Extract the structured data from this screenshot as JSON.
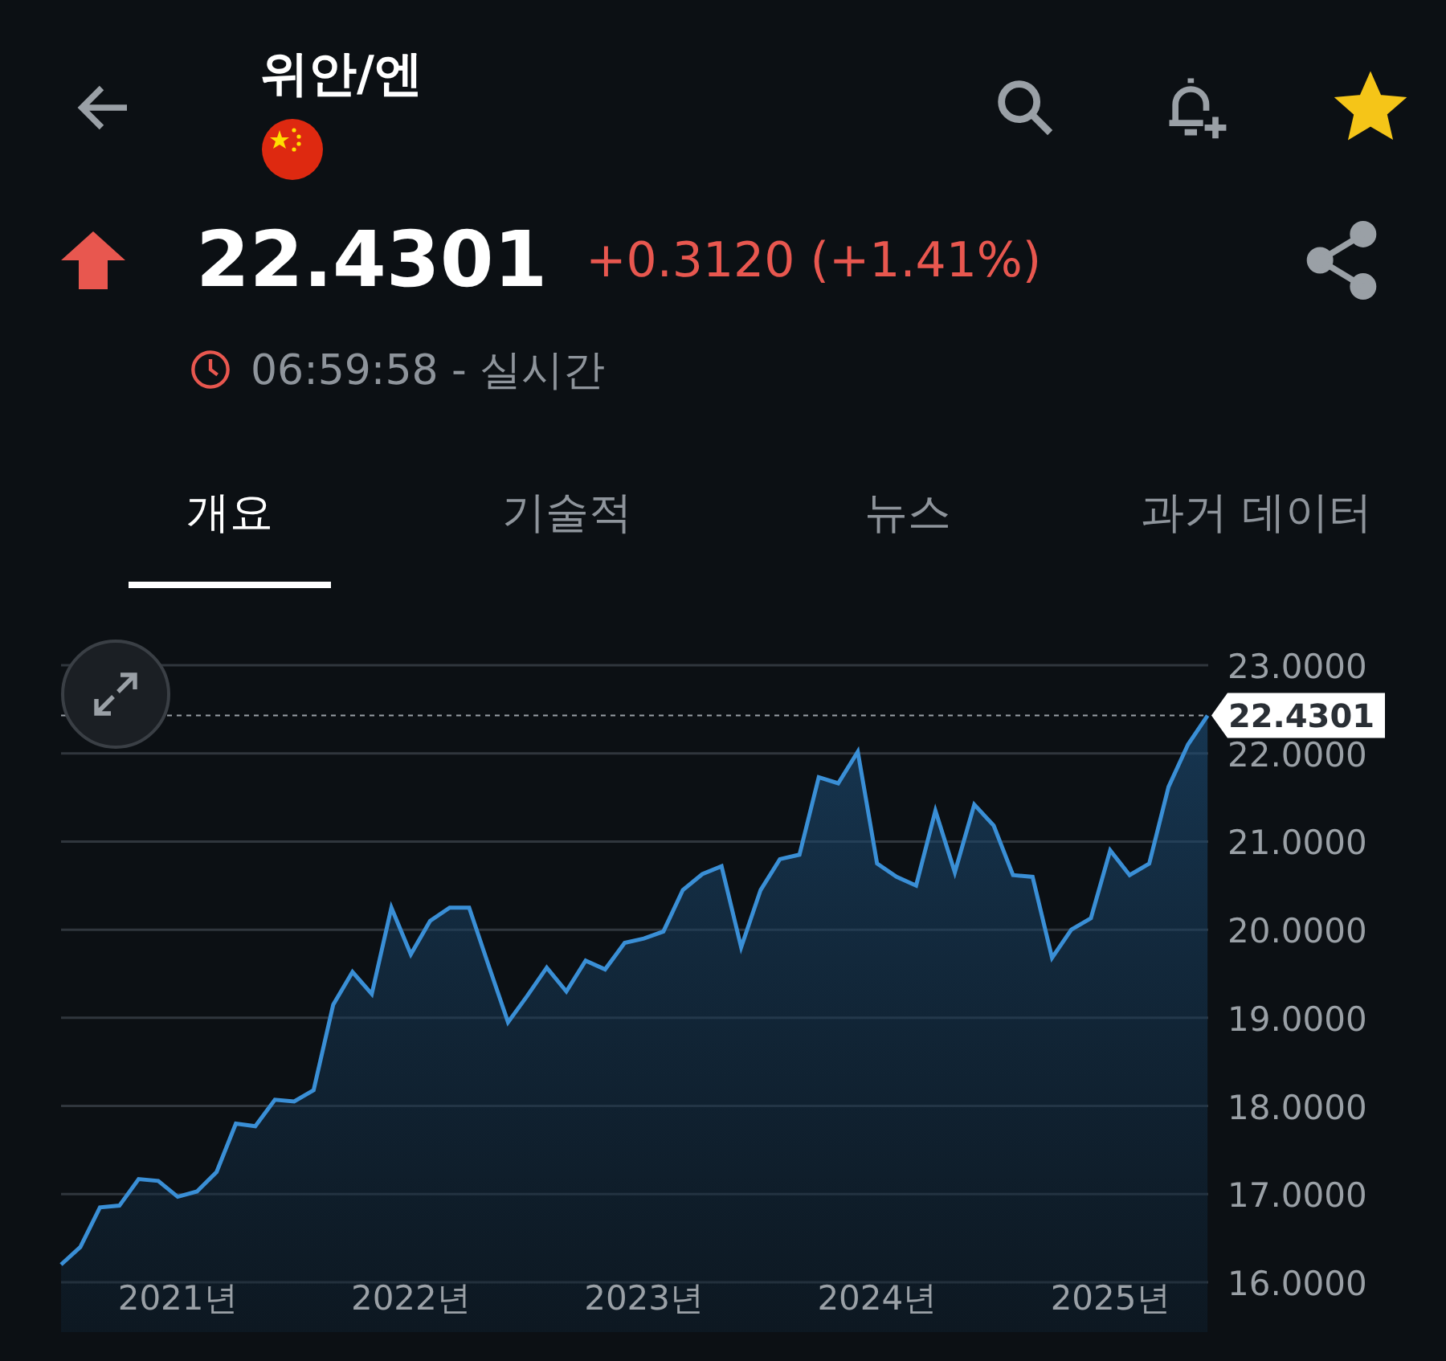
{
  "header": {
    "title": "위안/엔",
    "starred": true
  },
  "quote": {
    "up": true,
    "price": "22.4301",
    "change": "+0.3120 (+1.41%)",
    "time": "06:59:58 - 실시간"
  },
  "tabs": [
    {
      "label": "개요",
      "selected": true
    },
    {
      "label": "기술적",
      "selected": false
    },
    {
      "label": "뉴스",
      "selected": false
    },
    {
      "label": "과거 데이터",
      "selected": false
    }
  ],
  "chart": {
    "chart_data": {
      "type": "area",
      "grid": true,
      "ylim": [
        16,
        23
      ],
      "yticks": [
        {
          "value": 23,
          "label": "23.0000"
        },
        {
          "value": 22,
          "label": "22.0000"
        },
        {
          "value": 21,
          "label": "21.0000"
        },
        {
          "value": 20,
          "label": "20.0000"
        },
        {
          "value": 19,
          "label": "19.0000"
        },
        {
          "value": 18,
          "label": "18.0000"
        },
        {
          "value": 17,
          "label": "17.0000"
        },
        {
          "value": 16,
          "label": "16.0000"
        }
      ],
      "xticks": [
        {
          "value": 2021,
          "label": "2021년"
        },
        {
          "value": 2022,
          "label": "2022년"
        },
        {
          "value": 2023,
          "label": "2023년"
        },
        {
          "value": 2024,
          "label": "2024년"
        },
        {
          "value": 2025,
          "label": "2025년"
        }
      ],
      "xlim": [
        2020.5,
        2025.42
      ],
      "x": [
        2020.5,
        2020.583,
        2020.667,
        2020.75,
        2020.833,
        2020.917,
        2021,
        2021.083,
        2021.167,
        2021.25,
        2021.333,
        2021.417,
        2021.5,
        2021.583,
        2021.667,
        2021.75,
        2021.833,
        2021.917,
        2022,
        2022.083,
        2022.167,
        2022.25,
        2022.333,
        2022.417,
        2022.5,
        2022.583,
        2022.667,
        2022.75,
        2022.833,
        2022.917,
        2023,
        2023.083,
        2023.167,
        2023.25,
        2023.333,
        2023.417,
        2023.5,
        2023.583,
        2023.667,
        2023.75,
        2023.833,
        2023.917,
        2024,
        2024.083,
        2024.167,
        2024.25,
        2024.333,
        2024.417,
        2024.5,
        2024.583,
        2024.667,
        2024.75,
        2024.833,
        2024.917,
        2025,
        2025.083,
        2025.167,
        2025.25,
        2025.333,
        2025.417
      ],
      "series": [
        {
          "color": "#3a8fd6",
          "values": [
            16.2,
            16.4,
            16.85,
            16.87,
            17.17,
            17.15,
            16.97,
            17.03,
            17.25,
            17.8,
            17.77,
            18.07,
            18.05,
            18.18,
            19.15,
            19.52,
            19.27,
            20.25,
            19.72,
            20.1,
            20.25,
            20.25,
            19.6,
            18.95,
            19.25,
            19.57,
            19.3,
            19.65,
            19.55,
            19.85,
            19.9,
            19.98,
            20.45,
            20.63,
            20.72,
            19.8,
            20.45,
            20.8,
            20.85,
            21.73,
            21.66,
            22.02,
            20.75,
            20.6,
            20.5,
            21.35,
            20.65,
            21.42,
            21.18,
            20.62,
            20.6,
            19.68,
            20.0,
            20.13,
            20.9,
            20.62,
            20.75,
            21.62,
            22.1,
            22.43
          ]
        }
      ],
      "ref_lines": [
        {
          "axis": "y",
          "value": 22.4301,
          "label": "22.4301"
        }
      ]
    }
  }
}
